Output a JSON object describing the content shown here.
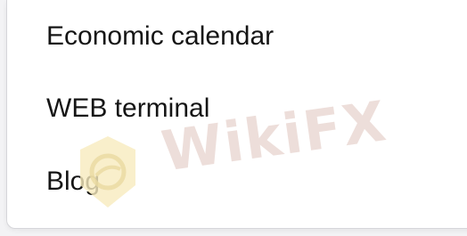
{
  "menu": {
    "items": [
      {
        "label": "Economic calendar"
      },
      {
        "label": "WEB terminal"
      },
      {
        "label": "Blog"
      }
    ]
  },
  "watermark": {
    "text": "WikiFX",
    "logo_icon": "wikifx-logo-icon"
  },
  "colors": {
    "panel_bg": "#ffffff",
    "page_bg": "#f3f3f5",
    "text": "#151515",
    "watermark_text": "#ead9d4",
    "watermark_logo": "#f6e7b4"
  }
}
